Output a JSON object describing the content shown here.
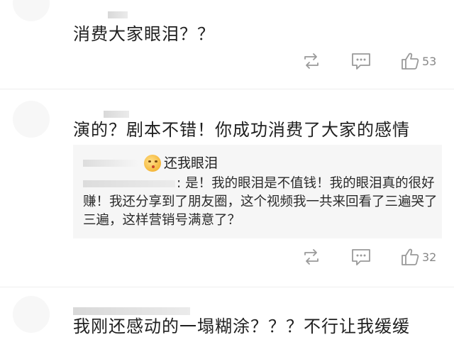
{
  "comments": [
    {
      "text": "消费大家眼泪？？",
      "actions": {
        "repost_icon": "repost-icon",
        "comment_icon": "comment-icon",
        "like_icon": "thumbs-up-icon",
        "like_count": "53"
      }
    },
    {
      "text": "演的？剧本不错！你成功消费了大家的感情",
      "reply": {
        "name": "还我眼泪",
        "text": "是！我的眼泪是不值钱！我的眼泪真的很好赚！我还分享到了朋友圈，这个视频我一共来回看了三遍哭了三遍，这样营销号满意了？"
      },
      "actions": {
        "repost_icon": "repost-icon",
        "comment_icon": "comment-icon",
        "like_icon": "thumbs-up-icon",
        "like_count": "32"
      }
    },
    {
      "text": "我刚还感动的一塌糊涂？？？不行让我缓缓"
    }
  ],
  "colors": {
    "text": "#222222",
    "icon": "#999999",
    "reply_background": "#f6f6f6"
  }
}
